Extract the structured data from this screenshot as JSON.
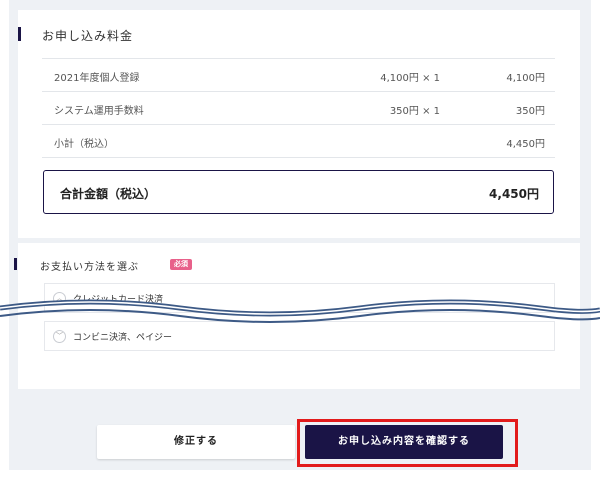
{
  "fee_section": {
    "title": "お申し込み料金",
    "rows": [
      {
        "name": "2021年度個人登録",
        "unit": "4,100円 × 1",
        "amount": "4,100円"
      },
      {
        "name": "システム運用手数料",
        "unit": "350円 × 1",
        "amount": "350円"
      },
      {
        "name": "小計（税込）",
        "unit": "",
        "amount": "4,450円"
      }
    ],
    "total": {
      "label": "合計金額（税込）",
      "value": "4,450円"
    }
  },
  "payment_section": {
    "title": "お支払い方法を選ぶ",
    "required_badge": "必須",
    "options": [
      {
        "label": "クレジットカード決済",
        "icon": "chevron-up-icon"
      },
      {
        "label": "コンビニ決済、ペイジー",
        "icon": "chevron-down-icon"
      }
    ]
  },
  "buttons": {
    "fix": "修正する",
    "confirm": "お申し込み内容を確認する"
  },
  "colors": {
    "navy": "#1a1446",
    "badge_pink": "#e8608a",
    "highlight_red": "#e21b1b",
    "wave_blue": "#3d5a86"
  }
}
